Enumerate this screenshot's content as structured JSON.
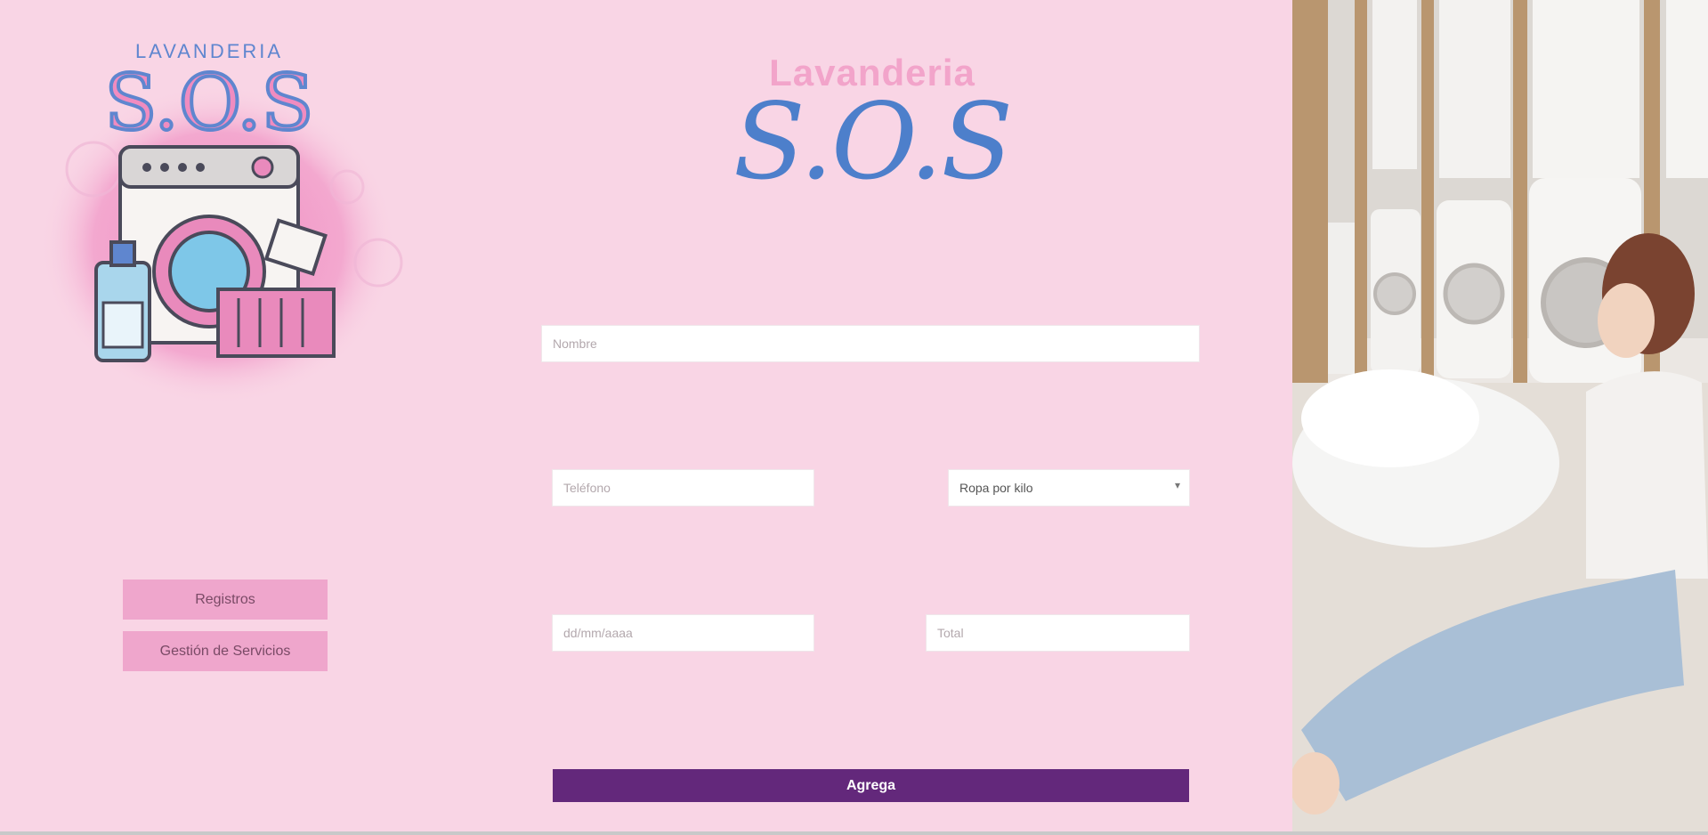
{
  "logo": {
    "small_text": "LAVANDERIA",
    "big_text": "S.O.S",
    "icon": "washing-machine-icon"
  },
  "brand": {
    "top": "Lavanderia",
    "main": "S.O.S"
  },
  "nav": {
    "registro": "Registros",
    "gestion": "Gestión de Servicios"
  },
  "form": {
    "nombre_placeholder": "Nombre",
    "telefono_placeholder": "Teléfono",
    "ropa_selected": "Ropa por kilo",
    "ingreso_placeholder": "dd/mm/aaaa",
    "total_placeholder": "Total",
    "submit": "Agrega"
  },
  "colors": {
    "background": "#f9d5e5",
    "brand_pink": "#f2a4ca",
    "brand_blue": "#4d7fcb",
    "nav_button": "#efa6cc",
    "submit_button": "#63287b"
  }
}
